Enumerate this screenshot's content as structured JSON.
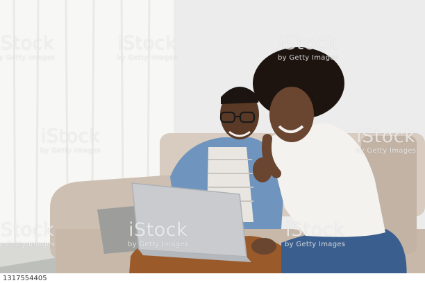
{
  "watermark": {
    "brand": "iStock",
    "sub": "by Getty Images"
  },
  "image_id": "1317554405",
  "colors": {
    "wall": "#ececec",
    "curtain": "#f7f7f5",
    "sofa": "#cbbcae",
    "denim_shirt": "#6f95bf",
    "blouse": "#f4f2ef",
    "jeans": "#3a5f8f",
    "pants": "#9b5a2a",
    "laptop": "#c9cbcf"
  }
}
